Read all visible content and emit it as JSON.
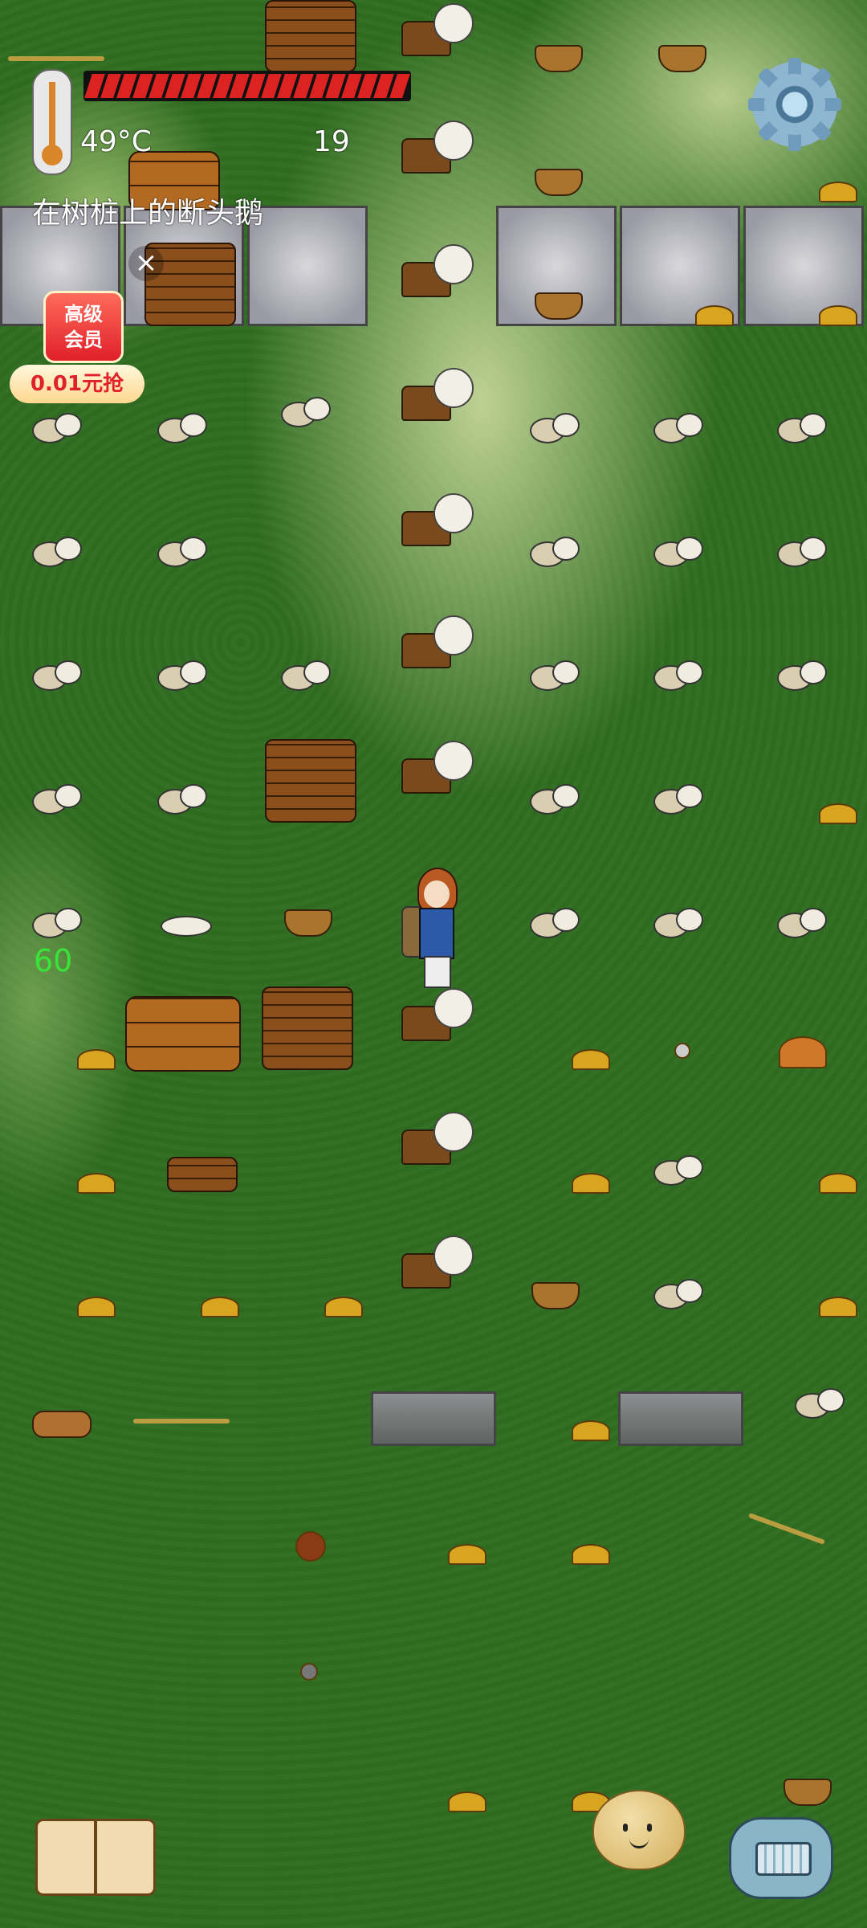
{
  "hud": {
    "temperature": "49°C",
    "score": "19",
    "status_text": "在树桩上的断头鹅",
    "health_fraction": 1.0,
    "damage_number": "60"
  },
  "ad": {
    "line1": "高级",
    "line2": "会员",
    "price": "0.01元抢",
    "close_glyph": "×"
  },
  "colors": {
    "health": "#d22222",
    "accent_ad": "#e0202a",
    "damage_text": "#39e439"
  },
  "icons": {
    "settings": "gear-icon",
    "thermometer": "thermometer-icon",
    "book": "book-icon",
    "emote": "potato-face-icon",
    "chat": "keyboard-icon"
  },
  "keyboard_glyph": "⌨"
}
